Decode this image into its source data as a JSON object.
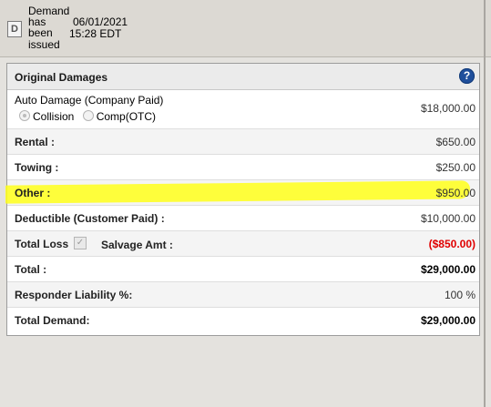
{
  "status": {
    "icon_letter": "D",
    "text": "Demand has been issued",
    "date": "06/01/2021",
    "time": "15:28 EDT"
  },
  "panel": {
    "title": "Original Damages",
    "help_icon_glyph": "?",
    "auto_damage": {
      "label": "Auto Damage (Company Paid)",
      "value": "$18,000.00",
      "options": [
        "Collision",
        "Comp(OTC)"
      ],
      "selected": "Collision"
    },
    "rental": {
      "label": "Rental :",
      "value": "$650.00"
    },
    "towing": {
      "label": "Towing :",
      "value": "$250.00"
    },
    "other": {
      "label": "Other :",
      "value": "$950.00",
      "highlight_color": "#ffff1a"
    },
    "deductible": {
      "label": "Deductible (Customer Paid) :",
      "value": "$10,000.00"
    },
    "total_loss": {
      "label": "Total Loss",
      "checked": true,
      "salvage_label": "Salvage Amt :",
      "salvage_value": "($850.00)",
      "salvage_color": "#e00000"
    },
    "total": {
      "label": "Total :",
      "value": "$29,000.00"
    },
    "responder_liability": {
      "label": "Responder Liability %:",
      "value": "100 %"
    },
    "total_demand": {
      "label": "Total Demand:",
      "value": "$29,000.00"
    }
  }
}
